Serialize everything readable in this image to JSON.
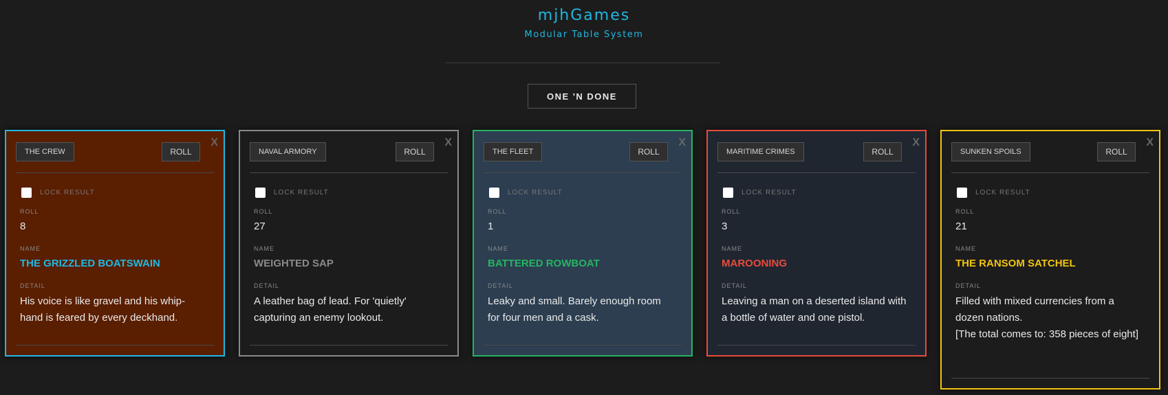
{
  "header": {
    "brand": "mjhGames",
    "subtitle": "Modular Table System"
  },
  "mode_button": "ONE 'N DONE",
  "common": {
    "roll_button": "ROLL",
    "close": "X",
    "lock_label": "LOCK RESULT",
    "roll_label": "ROLL",
    "name_label": "NAME",
    "detail_label": "DETAIL"
  },
  "cards": [
    {
      "table": "THE CREW",
      "roll": "8",
      "name": "THE GRIZZLED BOATSWAIN",
      "detail": "His voice is like gravel and his whip-hand is feared by every deckhand.",
      "border_color": "#1fb9e3",
      "background_color": "#5a1e00",
      "name_color": "#1fb9e3"
    },
    {
      "table": "NAVAL ARMORY",
      "roll": "27",
      "name": "WEIGHTED SAP",
      "detail": "A leather bag of lead. For 'quietly' capturing an enemy lookout.",
      "border_color": "#8a8a8a",
      "background_color": "#1c1c1c",
      "name_color": "#8a8a8a"
    },
    {
      "table": "THE FLEET",
      "roll": "1",
      "name": "BATTERED ROWBOAT",
      "detail": "Leaky and small. Barely enough room for four men and a cask.",
      "border_color": "#25b463",
      "background_color": "#2c3e50",
      "name_color": "#25b463"
    },
    {
      "table": "MARITIME CRIMES",
      "roll": "3",
      "name": "MAROONING",
      "detail": "Leaving a man on a deserted island with a bottle of water and one pistol.",
      "border_color": "#e74c3c",
      "background_color": "#1f2630",
      "name_color": "#e74c3c"
    },
    {
      "table": "SUNKEN SPOILS",
      "roll": "21",
      "name": "THE RANSOM SATCHEL",
      "detail": "Filled with mixed currencies from a dozen nations.",
      "detail_extra": "[The total comes to: 358 pieces of eight]",
      "border_color": "#f1c40f",
      "background_color": "#1c1c1c",
      "name_color": "#f1c40f"
    }
  ]
}
